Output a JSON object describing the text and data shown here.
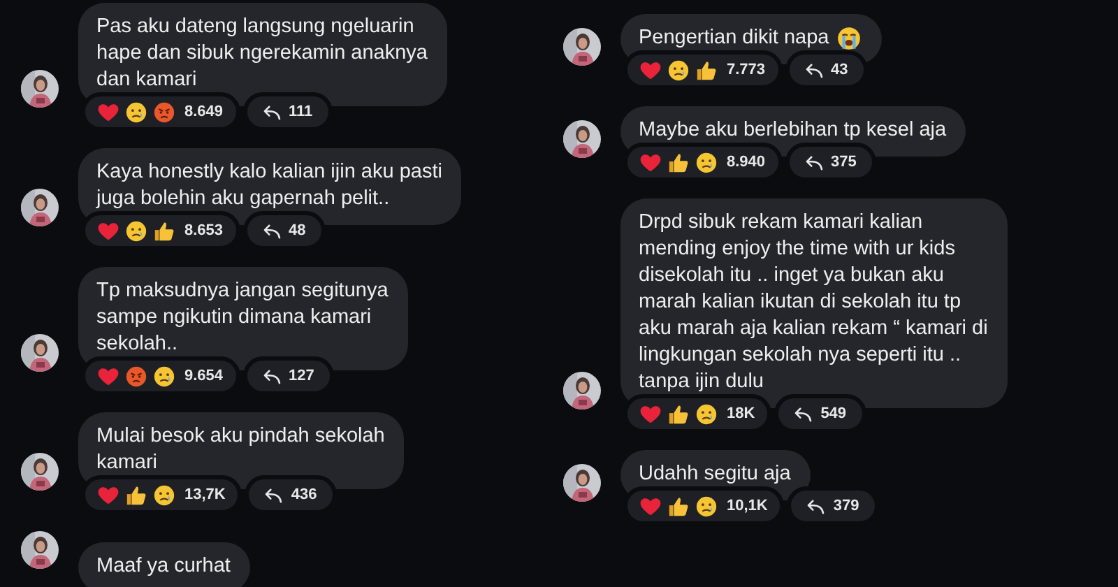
{
  "columns": [
    {
      "messages": [
        {
          "text": "Pas aku dateng langsung ngeluarin\nhape dan sibuk ngerekamin anaknya\ndan kamari",
          "reactions": [
            {
              "kind": "heart"
            },
            {
              "kind": "sad"
            },
            {
              "kind": "angry"
            }
          ],
          "reaction_count": "8.649",
          "reply_count": "111"
        },
        {
          "text": "Kaya honestly kalo kalian ijin aku pasti\njuga bolehin aku gapernah pelit..",
          "reactions": [
            {
              "kind": "heart"
            },
            {
              "kind": "sad"
            },
            {
              "kind": "thumbs"
            }
          ],
          "reaction_count": "8.653",
          "reply_count": "48"
        },
        {
          "text": "Tp maksudnya jangan segitunya\nsampe ngikutin dimana kamari\nsekolah..",
          "reactions": [
            {
              "kind": "heart"
            },
            {
              "kind": "angry"
            },
            {
              "kind": "sad"
            }
          ],
          "reaction_count": "9.654",
          "reply_count": "127"
        },
        {
          "text": "Mulai besok aku pindah sekolah\nkamari",
          "reactions": [
            {
              "kind": "heart"
            },
            {
              "kind": "thumbs"
            },
            {
              "kind": "sad"
            }
          ],
          "reaction_count": "13,7K",
          "reply_count": "436"
        },
        {
          "text": "Maaf ya curhat"
        }
      ]
    },
    {
      "messages": [
        {
          "text": "Pengertian dikit napa",
          "end_icon": {
            "kind": "crying"
          },
          "reactions": [
            {
              "kind": "heart"
            },
            {
              "kind": "sad"
            },
            {
              "kind": "thumbs"
            }
          ],
          "reaction_count": "7.773",
          "reply_count": "43"
        },
        {
          "text": "Maybe aku berlebihan tp kesel aja",
          "reactions": [
            {
              "kind": "heart"
            },
            {
              "kind": "thumbs"
            },
            {
              "kind": "sad"
            }
          ],
          "reaction_count": "8.940",
          "reply_count": "375"
        },
        {
          "text": "Drpd sibuk rekam kamari kalian\nmending enjoy the time with ur kids\ndisekolah itu .. inget ya bukan aku\nmarah kalian ikutan di sekolah itu tp\naku marah aja kalian rekam “ kamari di\nlingkungan sekolah nya seperti itu ..\ntanpa ijin dulu",
          "reactions": [
            {
              "kind": "heart"
            },
            {
              "kind": "thumbs"
            },
            {
              "kind": "sad"
            }
          ],
          "reaction_count": "18K",
          "reply_count": "549"
        },
        {
          "text": "Udahh segitu aja",
          "reactions": [
            {
              "kind": "heart"
            },
            {
              "kind": "thumbs"
            },
            {
              "kind": "sad"
            }
          ],
          "reaction_count": "10,1K",
          "reply_count": "379"
        }
      ]
    }
  ]
}
